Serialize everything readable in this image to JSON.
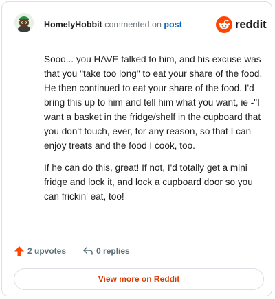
{
  "header": {
    "username": "HomelyHobbit",
    "action": "commented on",
    "post_link": "post",
    "logo_text": "reddit"
  },
  "comment": {
    "paragraphs": [
      "Sooo... you HAVE talked to him, and his excuse was that you \"take too long\" to eat your share of the food. He then continued to eat your share of the food. I'd bring this up to him and tell him what you want, ie -\"I want a basket in the fridge/shelf in the cupboard that you don't touch, ever, for any reason, so that I can enjoy treats and the food I cook, too.",
      "If he can do this, great! If not, I'd totally get a mini fridge and lock it, and lock a cupboard door so you can frickin' eat, too!"
    ]
  },
  "meta": {
    "upvotes": "2 upvotes",
    "replies": "0 replies"
  },
  "footer": {
    "view_more": "View more on Reddit"
  },
  "colors": {
    "upvote": "#ff4500",
    "link": "#0a66c2",
    "view_more": "#d93a00"
  },
  "icons": {
    "avatar": "avatar-snoo-icon",
    "logo": "reddit-logo-icon",
    "upvote": "upvote-arrow-icon",
    "reply": "reply-arrow-icon"
  }
}
